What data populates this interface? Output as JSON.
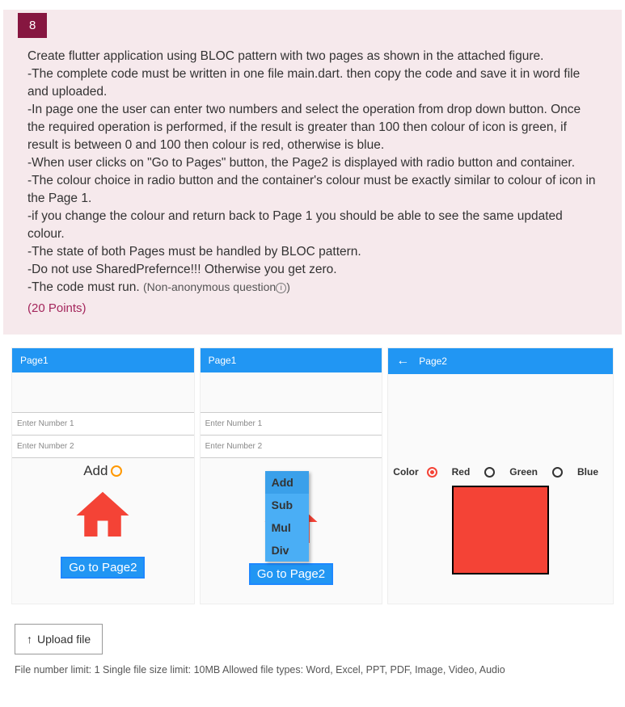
{
  "question": {
    "number": "8",
    "lines": [
      "Create flutter application using BLOC pattern with two pages as shown in the attached figure.",
      "-The complete code must be written in one file main.dart. then copy the code and save it in word file and uploaded.",
      "-In page one the user can enter two numbers and select the operation from drop down button. Once the required operation is performed, if the result is greater than 100 then colour of icon is green, if result is between 0 and 100 then colour is red, otherwise is blue.",
      "-When user clicks on \"Go to Pages\" button, the Page2 is displayed with radio button and container.",
      "-The colour choice in radio button and the container's colour must be exactly similar to colour of icon in the Page 1.",
      "-if you change the colour and return back to Page 1 you should be able to see the same updated colour.",
      "-The state of both Pages must be handled by BLOC pattern.",
      "-Do not use SharedPrefernce!!! Otherwise you get zero."
    ],
    "last_line_prefix": "-The code must run. ",
    "non_anonymous": "(Non-anonymous question",
    "non_anonymous_close": ")",
    "points": "(20 Points)"
  },
  "page1": {
    "title": "Page1",
    "enter1": "Enter Number 1",
    "enter2": "Enter Number 2",
    "addLabel": "Add",
    "goBtn": "Go to Page2"
  },
  "dropdown": {
    "items": [
      "Add",
      "Sub",
      "Mul",
      "Div"
    ]
  },
  "page2": {
    "title": "Page2",
    "colorLabel": "Color",
    "red": "Red",
    "green": "Green",
    "blue": "Blue"
  },
  "upload": {
    "button": "Upload file",
    "limits": "File number limit: 1    Single file size limit: 10MB    Allowed file types: Word, Excel, PPT, PDF, Image, Video, Audio"
  }
}
